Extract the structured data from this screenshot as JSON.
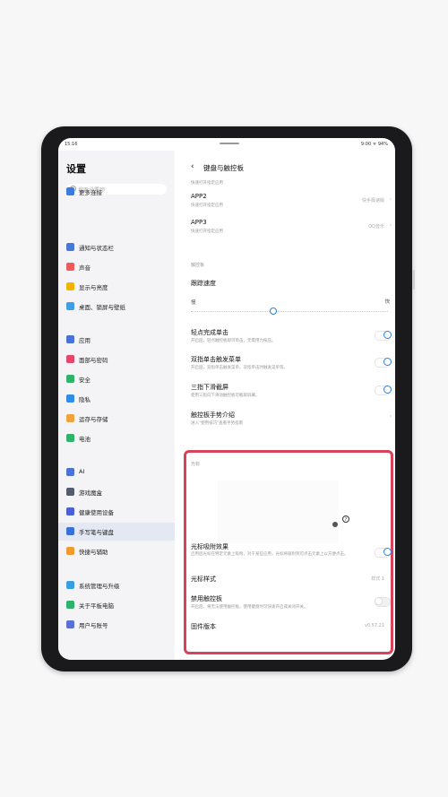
{
  "status": {
    "time": "15:16",
    "right": "9:00 ᯤ 94%"
  },
  "sidebar": {
    "title": "设置",
    "search_placeholder": "搜索设置项",
    "items": [
      {
        "label": "更多连接",
        "icon": "link-icon",
        "color": "#3a7be0"
      },
      {
        "label": "通知与状态栏",
        "icon": "notification-icon",
        "color": "#4a78d6"
      },
      {
        "label": "声音",
        "icon": "sound-icon",
        "color": "#ee5a5a"
      },
      {
        "label": "显示与亮度",
        "icon": "brightness-icon",
        "color": "#f3b400"
      },
      {
        "label": "桌面、锁屏与壁纸",
        "icon": "wallpaper-icon",
        "color": "#3f9fe6"
      },
      {
        "label": "应用",
        "icon": "apps-icon",
        "color": "#4a72d8"
      },
      {
        "label": "面部与密码",
        "icon": "face-icon",
        "color": "#e8456a"
      },
      {
        "label": "安全",
        "icon": "shield-icon",
        "color": "#2fb36b"
      },
      {
        "label": "隐私",
        "icon": "privacy-icon",
        "color": "#2e8de6"
      },
      {
        "label": "运存与存储",
        "icon": "storage-icon",
        "color": "#f2a23a"
      },
      {
        "label": "电池",
        "icon": "battery-icon",
        "color": "#2fb36b"
      },
      {
        "label": "AI",
        "icon": "ai-icon",
        "color": "#4a72d8"
      },
      {
        "label": "游戏魔盒",
        "icon": "game-icon",
        "color": "#555c6b"
      },
      {
        "label": "健康使用设备",
        "icon": "hourglass-icon",
        "color": "#4a5fd8"
      },
      {
        "label": "手写笔与键盘",
        "icon": "pen-icon",
        "color": "#3a6fd8"
      },
      {
        "label": "快捷与辅助",
        "icon": "shortcut-icon",
        "color": "#f29a2e"
      },
      {
        "label": "系统管理与升级",
        "icon": "system-icon",
        "color": "#3a9fe0"
      },
      {
        "label": "关于平板电脑",
        "icon": "info-icon",
        "color": "#2fb36b"
      },
      {
        "label": "用户与账号",
        "icon": "user-icon",
        "color": "#5a6fd8"
      }
    ]
  },
  "main": {
    "title": "键盘与触控板",
    "top_sub": "快速打开指定应用",
    "app2": {
      "title": "APP2",
      "sub": "快速打开指定应用",
      "value": "快手极速版"
    },
    "app3": {
      "title": "APP3",
      "sub": "快速打开指定应用",
      "value": "QQ音乐"
    },
    "touchpad_section": "触控板",
    "tracking": {
      "title": "跟踪速度",
      "slow": "慢",
      "fast": "快",
      "value": 0.42
    },
    "tap_click": {
      "title": "轻点完成单击",
      "sub": "开启后，轻点触控板即可单击，无需用力按压。",
      "on": true
    },
    "two_finger": {
      "title": "双指单击触发菜单",
      "sub": "开启后，双指单击触发菜单。双指单击时触发菜单等。",
      "on": true
    },
    "three_finger": {
      "title": "三指下滑截屏",
      "sub": "使用三指向下滑动触控板可截取屏幕。",
      "on": true
    },
    "gesture": {
      "title": "触控板手势介绍",
      "sub": "进入\"使用技巧\"查看手势指南"
    },
    "cursor_section": "光标",
    "cursor_snap": {
      "title": "光标吸附效果",
      "sub": "启用后光标在特定元素上吸附，对于某些应用，光标将吸附到可点击元素上以方便点击。",
      "on": true
    },
    "cursor_style": {
      "title": "光标样式",
      "value": "样式 1"
    },
    "disable_touchpad": {
      "title": "禁用触控板",
      "sub": "开启后，将无法使用触控板。使用键盘时可快速开启或关闭开关。",
      "on": false
    },
    "firmware": {
      "title": "固件版本",
      "value": "v0.57.21"
    }
  }
}
